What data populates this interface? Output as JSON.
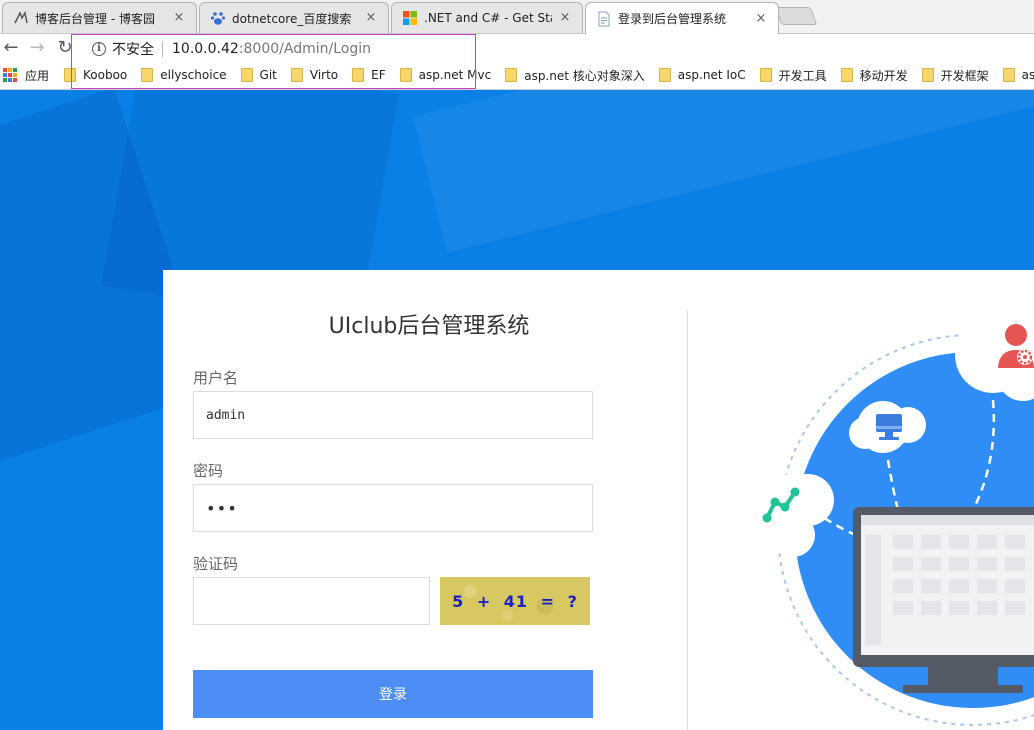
{
  "tabs": [
    {
      "title": "博客后台管理 - 博客园",
      "close": "×"
    },
    {
      "title": "dotnetcore_百度搜索",
      "close": "×"
    },
    {
      "title": ".NET and C# - Get Start",
      "close": "×"
    },
    {
      "title": "登录到后台管理系统",
      "close": "×"
    }
  ],
  "nav": {
    "back": "←",
    "forward": "→",
    "reload": "↻"
  },
  "address": {
    "security_label": "不安全",
    "host": "10.0.0.42",
    "path": ":8000/Admin/Login",
    "info_glyph": "i"
  },
  "bookmarks": {
    "apps_label": "应用",
    "items": [
      "Kooboo",
      "ellyschoice",
      "Git",
      "Virto",
      "EF",
      "asp.net Mvc",
      "asp.net 核心对象深入",
      "asp.net  IoC",
      "开发工具",
      "移动开发",
      "开发框架",
      "asp.n"
    ]
  },
  "login": {
    "title": "UIclub后台管理系统",
    "username_label": "用户名",
    "username_value": "admin",
    "password_label": "密码",
    "password_value": "•••",
    "captcha_label": "验证码",
    "captcha_value": "",
    "captcha_text": "5 + 41 = ?",
    "submit_label": "登录"
  },
  "colors": {
    "page_bg": "#0a7fe6",
    "button": "#4c8df6",
    "captcha_text": "#1a22c8",
    "captcha_bg": "#d8c862"
  },
  "icons": {
    "chart": "trend-chart-icon",
    "monitor": "monitor-icon",
    "user": "user-settings-icon"
  }
}
